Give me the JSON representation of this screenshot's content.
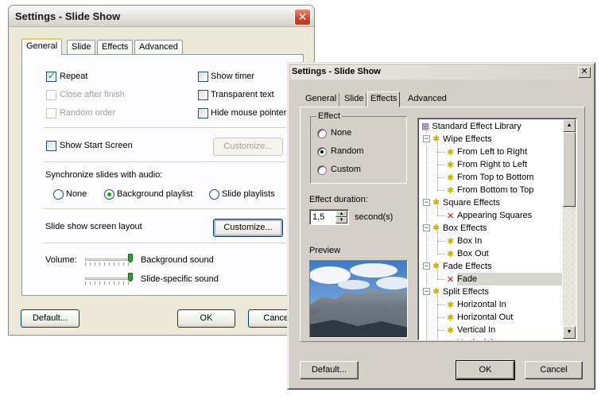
{
  "back_window": {
    "title": "Settings - Slide Show",
    "tabs": [
      "General",
      "Slide",
      "Effects",
      "Advanced"
    ],
    "checkboxes": {
      "repeat": "Repeat",
      "close_after_finish": "Close after finish",
      "random_order": "Random order",
      "show_timer": "Show timer",
      "transparent_text": "Transparent text",
      "hide_mouse_pointer": "Hide mouse pointer",
      "show_start_screen": "Show Start Screen"
    },
    "customize_label": "Customize...",
    "sync_label": "Synchronize slides with audio:",
    "sync_options": [
      "None",
      "Background playlist",
      "Slide playlists"
    ],
    "sync_selected": "Background playlist",
    "layout_label": "Slide show screen layout",
    "layout_button": "Customize...",
    "volume_label": "Volume:",
    "volume_background": "Background sound",
    "volume_slide": "Slide-specific sound",
    "buttons": {
      "default": "Default...",
      "ok": "OK",
      "cancel": "Cancel"
    }
  },
  "front_window": {
    "title": "Settings - Slide Show",
    "tabs": [
      "General",
      "Slide",
      "Effects",
      "Advanced"
    ],
    "active_tab": "Effects",
    "effect_group": "Effect",
    "effect_options": [
      "None",
      "Random",
      "Custom"
    ],
    "effect_selected": "Random",
    "duration_label": "Effect duration:",
    "duration_value": "1,5",
    "duration_unit": "second(s)",
    "preview_label": "Preview",
    "tree": {
      "root": "Standard Effect Library",
      "groups": [
        {
          "name": "Wipe Effects",
          "items": [
            "From Left to Right",
            "From Right to Left",
            "From Top to Bottom",
            "From Bottom to Top"
          ]
        },
        {
          "name": "Square Effects",
          "items": [
            "Appearing Squares"
          ]
        },
        {
          "name": "Box Effects",
          "items": [
            "Box In",
            "Box Out"
          ]
        },
        {
          "name": "Fade Effects",
          "items": [
            "Fade"
          ]
        },
        {
          "name": "Split Effects",
          "items": [
            "Horizontal In",
            "Horizontal Out",
            "Vertical In",
            "Vertical Out"
          ]
        }
      ],
      "selected": "Fade"
    },
    "buttons": {
      "default": "Default...",
      "ok": "OK",
      "cancel": "Cancel"
    }
  }
}
